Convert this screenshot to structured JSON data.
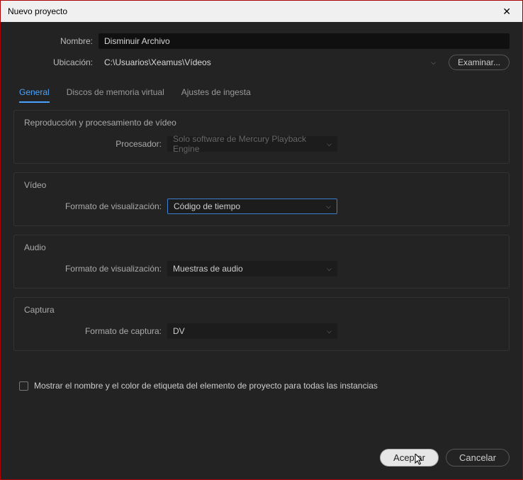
{
  "titlebar": {
    "title": "Nuevo proyecto"
  },
  "form": {
    "name_label": "Nombre:",
    "name_value": "Disminuir Archivo",
    "location_label": "Ubicación:",
    "location_value": "C:\\Usuarios\\Xeamus\\Vídeos",
    "browse": "Examinar..."
  },
  "tabs": {
    "general": "General",
    "scratch": "Discos de memoria virtual",
    "ingest": "Ajustes de ingesta"
  },
  "sections": {
    "playback": {
      "title": "Reproducción y procesamiento de vídeo",
      "renderer_label": "Procesador:",
      "renderer_value": "Solo software de Mercury Playback Engine"
    },
    "video": {
      "title": "Vídeo",
      "format_label": "Formato de visualización:",
      "format_value": "Código de tiempo"
    },
    "audio": {
      "title": "Audio",
      "format_label": "Formato de visualización:",
      "format_value": "Muestras de audio"
    },
    "capture": {
      "title": "Captura",
      "format_label": "Formato de captura:",
      "format_value": "DV"
    }
  },
  "checkbox": {
    "label": "Mostrar el nombre y el color de etiqueta del elemento de proyecto para todas las instancias"
  },
  "footer": {
    "ok": "Aceptar",
    "cancel": "Cancelar"
  }
}
